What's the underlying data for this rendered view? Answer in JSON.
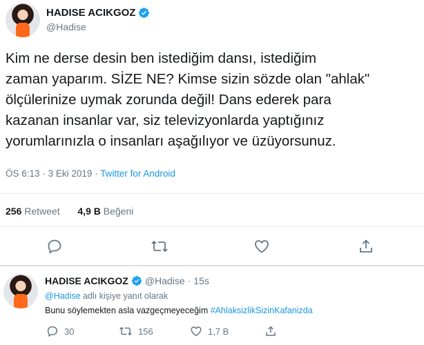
{
  "main_tweet": {
    "display_name": "HADISE ACIKGOZ",
    "handle": "@Hadise",
    "text": "Kim ne derse desin ben istediğim dansı, istediğim\nzaman yaparım. SİZE NE? Kimse sizin sözde olan \"ahlak\"\nölçülerinize uymak zorunda değil! Dans ederek para\nkazanan insanlar var, siz televizyonlarda yaptığınız\nyorumlarınızla o insanları aşağılıyor ve üzüyorsunuz.",
    "time": "ÖS 6:13",
    "date": "3 Eki 2019",
    "separator": "·",
    "source": "Twitter for Android",
    "retweet_count": "256",
    "retweet_label": "Retweet",
    "like_count": "4,9 B",
    "like_label": "Beğeni"
  },
  "reply_tweet": {
    "display_name": "HADISE ACIKGOZ",
    "handle": "@Hadise",
    "separator": "·",
    "time_ago": "15s",
    "replying_to_handle": "@Hadise",
    "replying_to_suffix": "adlı kişiye yanıt olarak",
    "text": "Bunu söylemekten asla vazgeçmeyeceğim",
    "hashtag": "#AhlaksizlikSizinKafanizda",
    "reply_count": "30",
    "retweet_count": "156",
    "like_count": "1,7 B"
  },
  "colors": {
    "link": "#1b95e0",
    "verified": "#1da1f2",
    "muted": "#657786",
    "icon": "#657786"
  },
  "icons": [
    "verified-badge-icon",
    "reply-icon",
    "retweet-icon",
    "like-icon",
    "share-icon"
  ]
}
